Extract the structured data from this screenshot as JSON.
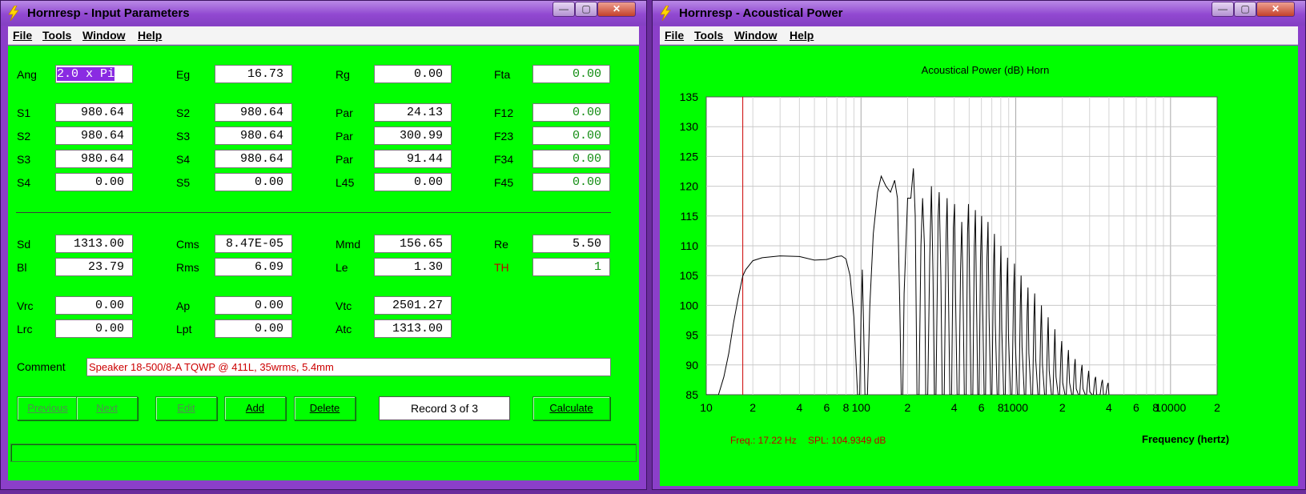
{
  "colors": {
    "client_bg": "#00ff00",
    "title_bar": "#9148d1",
    "grid": "#c8c8c8",
    "cursor": "#cc0000",
    "trace": "#000000",
    "accent_red": "#c00000",
    "green_value": "#118c11"
  },
  "left_window": {
    "title": "Hornresp - Input Parameters",
    "menu": [
      "File",
      "Tools",
      "Window",
      "Help"
    ],
    "controls": {
      "min": "—",
      "max": "▢",
      "close": "✕"
    },
    "rows_top": [
      [
        {
          "label": "Ang",
          "value": "2.0 x Pi"
        },
        {
          "label": "Eg",
          "value": "16.73"
        },
        {
          "label": "Rg",
          "value": "0.00"
        },
        {
          "label": "Fta",
          "value": "0.00"
        }
      ],
      [
        {
          "label": "S1",
          "value": "980.64"
        },
        {
          "label": "S2",
          "value": "980.64"
        },
        {
          "label": "Par",
          "value": "24.13"
        },
        {
          "label": "F12",
          "value": "0.00"
        }
      ],
      [
        {
          "label": "S2",
          "value": "980.64"
        },
        {
          "label": "S3",
          "value": "980.64"
        },
        {
          "label": "Par",
          "value": "300.99"
        },
        {
          "label": "F23",
          "value": "0.00"
        }
      ],
      [
        {
          "label": "S3",
          "value": "980.64"
        },
        {
          "label": "S4",
          "value": "980.64"
        },
        {
          "label": "Par",
          "value": "91.44"
        },
        {
          "label": "F34",
          "value": "0.00"
        }
      ],
      [
        {
          "label": "S4",
          "value": "0.00"
        },
        {
          "label": "S5",
          "value": "0.00"
        },
        {
          "label": "L45",
          "value": "0.00"
        },
        {
          "label": "F45",
          "value": "0.00"
        }
      ]
    ],
    "rows_mid": [
      [
        {
          "label": "Sd",
          "value": "1313.00"
        },
        {
          "label": "Cms",
          "value": "8.47E-05"
        },
        {
          "label": "Mmd",
          "value": "156.65"
        },
        {
          "label": "Re",
          "value": "5.50"
        }
      ],
      [
        {
          "label": "Bl",
          "value": "23.79"
        },
        {
          "label": "Rms",
          "value": "6.09"
        },
        {
          "label": "Le",
          "value": "1.30"
        },
        {
          "label": "TH",
          "value": "1"
        }
      ]
    ],
    "rows_bottom": [
      [
        {
          "label": "Vrc",
          "value": "0.00"
        },
        {
          "label": "Ap",
          "value": "0.00"
        },
        {
          "label": "Vtc",
          "value": "2501.27"
        }
      ],
      [
        {
          "label": "Lrc",
          "value": "0.00"
        },
        {
          "label": "Lpt",
          "value": "0.00"
        },
        {
          "label": "Atc",
          "value": "1313.00"
        }
      ]
    ],
    "comment_label": "Comment",
    "comment_value": "Speaker 18-500/8-A TQWP @ 411L, 35wrms, 5.4mm",
    "buttons": {
      "previous": "Previous",
      "next": "Next",
      "edit": "Edit",
      "add": "Add",
      "delete": "Delete",
      "calculate": "Calculate"
    },
    "record": "Record 3 of 3"
  },
  "right_window": {
    "title": "Hornresp - Acoustical Power",
    "menu": [
      "File",
      "Tools",
      "Window",
      "Help"
    ],
    "controls": {
      "min": "—",
      "max": "▢",
      "close": "✕"
    },
    "chart_title": "Acoustical Power (dB)   Horn",
    "freq_readout": "Freq.: 17.22 Hz",
    "spl_readout": "SPL: 104.9349 dB",
    "x_axis_label": "Frequency (hertz)"
  },
  "chart_data": {
    "type": "line",
    "title": "Acoustical Power (dB)   Horn",
    "xlabel": "Frequency (hertz)",
    "ylabel": "",
    "x_scale": "log",
    "xlim": [
      10,
      20000
    ],
    "ylim": [
      85,
      135
    ],
    "grid": true,
    "x_tick_labels": [
      {
        "x": 10,
        "label": "10"
      },
      {
        "x": 20,
        "label": "2"
      },
      {
        "x": 40,
        "label": "4"
      },
      {
        "x": 60,
        "label": "6"
      },
      {
        "x": 80,
        "label": "8"
      },
      {
        "x": 100,
        "label": "100"
      },
      {
        "x": 200,
        "label": "2"
      },
      {
        "x": 400,
        "label": "4"
      },
      {
        "x": 600,
        "label": "6"
      },
      {
        "x": 800,
        "label": "8"
      },
      {
        "x": 1000,
        "label": "1000"
      },
      {
        "x": 2000,
        "label": "2"
      },
      {
        "x": 4000,
        "label": "4"
      },
      {
        "x": 6000,
        "label": "6"
      },
      {
        "x": 8000,
        "label": "8"
      },
      {
        "x": 10000,
        "label": "10000"
      },
      {
        "x": 20000,
        "label": "2"
      }
    ],
    "y_ticks": [
      85,
      90,
      95,
      100,
      105,
      110,
      115,
      120,
      125,
      130,
      135
    ],
    "cursor_x": 17.22,
    "series": [
      {
        "points": [
          [
            10,
            85
          ],
          [
            11,
            85
          ],
          [
            12,
            85
          ],
          [
            13,
            88
          ],
          [
            14,
            92
          ],
          [
            15,
            97
          ],
          [
            16,
            101
          ],
          [
            17.22,
            104.93
          ],
          [
            18,
            106
          ],
          [
            20,
            107.5
          ],
          [
            23,
            108
          ],
          [
            30,
            108.3
          ],
          [
            40,
            108.2
          ],
          [
            50,
            107.6
          ],
          [
            60,
            107.7
          ],
          [
            70,
            108.2
          ],
          [
            75,
            108.3
          ],
          [
            80,
            107.8
          ],
          [
            85,
            105
          ],
          [
            90,
            98
          ],
          [
            93,
            90
          ],
          [
            95,
            85
          ],
          [
            98,
            85
          ],
          [
            100,
            98
          ],
          [
            102,
            106
          ],
          [
            104,
            96
          ],
          [
            106,
            85
          ],
          [
            110,
            85
          ],
          [
            114,
            100
          ],
          [
            120,
            112
          ],
          [
            128,
            119
          ],
          [
            135,
            121.7
          ],
          [
            145,
            120
          ],
          [
            155,
            119
          ],
          [
            165,
            121
          ],
          [
            172,
            118
          ],
          [
            178,
            100
          ],
          [
            182,
            85
          ],
          [
            186,
            85
          ],
          [
            190,
            102
          ],
          [
            200,
            118
          ],
          [
            210,
            118
          ],
          [
            218,
            123
          ],
          [
            224,
            115
          ],
          [
            230,
            85
          ],
          [
            237,
            85
          ],
          [
            244,
            110
          ],
          [
            250,
            118
          ],
          [
            257,
            110
          ],
          [
            262,
            85
          ],
          [
            270,
            85
          ],
          [
            278,
            108
          ],
          [
            285,
            120
          ],
          [
            292,
            105
          ],
          [
            298,
            85
          ],
          [
            305,
            85
          ],
          [
            315,
            115
          ],
          [
            320,
            119
          ],
          [
            328,
            105
          ],
          [
            335,
            85
          ],
          [
            345,
            85
          ],
          [
            355,
            112
          ],
          [
            360,
            118
          ],
          [
            365,
            108
          ],
          [
            375,
            85
          ],
          [
            385,
            85
          ],
          [
            395,
            113
          ],
          [
            402,
            117
          ],
          [
            408,
            102
          ],
          [
            418,
            85
          ],
          [
            430,
            85
          ],
          [
            440,
            106
          ],
          [
            448,
            114
          ],
          [
            455,
            105
          ],
          [
            465,
            85
          ],
          [
            478,
            85
          ],
          [
            488,
            112
          ],
          [
            495,
            117
          ],
          [
            503,
            104
          ],
          [
            515,
            85
          ],
          [
            528,
            85
          ],
          [
            540,
            110
          ],
          [
            548,
            116
          ],
          [
            556,
            103
          ],
          [
            568,
            85
          ],
          [
            580,
            85
          ],
          [
            592,
            108
          ],
          [
            602,
            115
          ],
          [
            611,
            100
          ],
          [
            624,
            85
          ],
          [
            638,
            85
          ],
          [
            652,
            108
          ],
          [
            662,
            114
          ],
          [
            672,
            98
          ],
          [
            688,
            85
          ],
          [
            702,
            85
          ],
          [
            718,
            106
          ],
          [
            728,
            112
          ],
          [
            738,
            97
          ],
          [
            758,
            85
          ],
          [
            775,
            85
          ],
          [
            792,
            104
          ],
          [
            802,
            110
          ],
          [
            812,
            96
          ],
          [
            835,
            85
          ],
          [
            855,
            85
          ],
          [
            875,
            103
          ],
          [
            885,
            108
          ],
          [
            897,
            95
          ],
          [
            925,
            85
          ],
          [
            945,
            85
          ],
          [
            968,
            102
          ],
          [
            980,
            107
          ],
          [
            992,
            94
          ],
          [
            1025,
            85
          ],
          [
            1050,
            85
          ],
          [
            1070,
            100
          ],
          [
            1082,
            105
          ],
          [
            1098,
            93
          ],
          [
            1135,
            85
          ],
          [
            1160,
            85
          ],
          [
            1185,
            99
          ],
          [
            1200,
            103
          ],
          [
            1215,
            92
          ],
          [
            1255,
            85
          ],
          [
            1285,
            85
          ],
          [
            1310,
            98
          ],
          [
            1325,
            102
          ],
          [
            1345,
            91
          ],
          [
            1390,
            85
          ],
          [
            1420,
            85
          ],
          [
            1450,
            96
          ],
          [
            1465,
            100
          ],
          [
            1488,
            90
          ],
          [
            1535,
            85
          ],
          [
            1570,
            85
          ],
          [
            1605,
            95
          ],
          [
            1620,
            98
          ],
          [
            1645,
            89
          ],
          [
            1700,
            85
          ],
          [
            1740,
            85
          ],
          [
            1775,
            93
          ],
          [
            1790,
            96
          ],
          [
            1820,
            88
          ],
          [
            1880,
            85
          ],
          [
            1920,
            85
          ],
          [
            1960,
            92
          ],
          [
            1980,
            94
          ],
          [
            2012,
            87
          ],
          [
            2080,
            85
          ],
          [
            2120,
            85
          ],
          [
            2170,
            91
          ],
          [
            2190,
            92.5
          ],
          [
            2225,
            87
          ],
          [
            2300,
            85
          ],
          [
            2345,
            85
          ],
          [
            2400,
            90
          ],
          [
            2420,
            91
          ],
          [
            2460,
            86
          ],
          [
            2540,
            85
          ],
          [
            2590,
            85
          ],
          [
            2650,
            89
          ],
          [
            2680,
            90
          ],
          [
            2720,
            86
          ],
          [
            2810,
            85
          ],
          [
            2865,
            85
          ],
          [
            2930,
            88
          ],
          [
            2960,
            89
          ],
          [
            3010,
            85.5
          ],
          [
            3110,
            85
          ],
          [
            3170,
            85
          ],
          [
            3240,
            87.5
          ],
          [
            3280,
            88
          ],
          [
            3330,
            85
          ],
          [
            3440,
            85
          ],
          [
            3510,
            85
          ],
          [
            3590,
            87
          ],
          [
            3630,
            87.5
          ],
          [
            3690,
            85
          ],
          [
            3820,
            85
          ],
          [
            3900,
            86.5
          ],
          [
            3950,
            87
          ],
          [
            4000,
            85
          ]
        ]
      }
    ]
  }
}
